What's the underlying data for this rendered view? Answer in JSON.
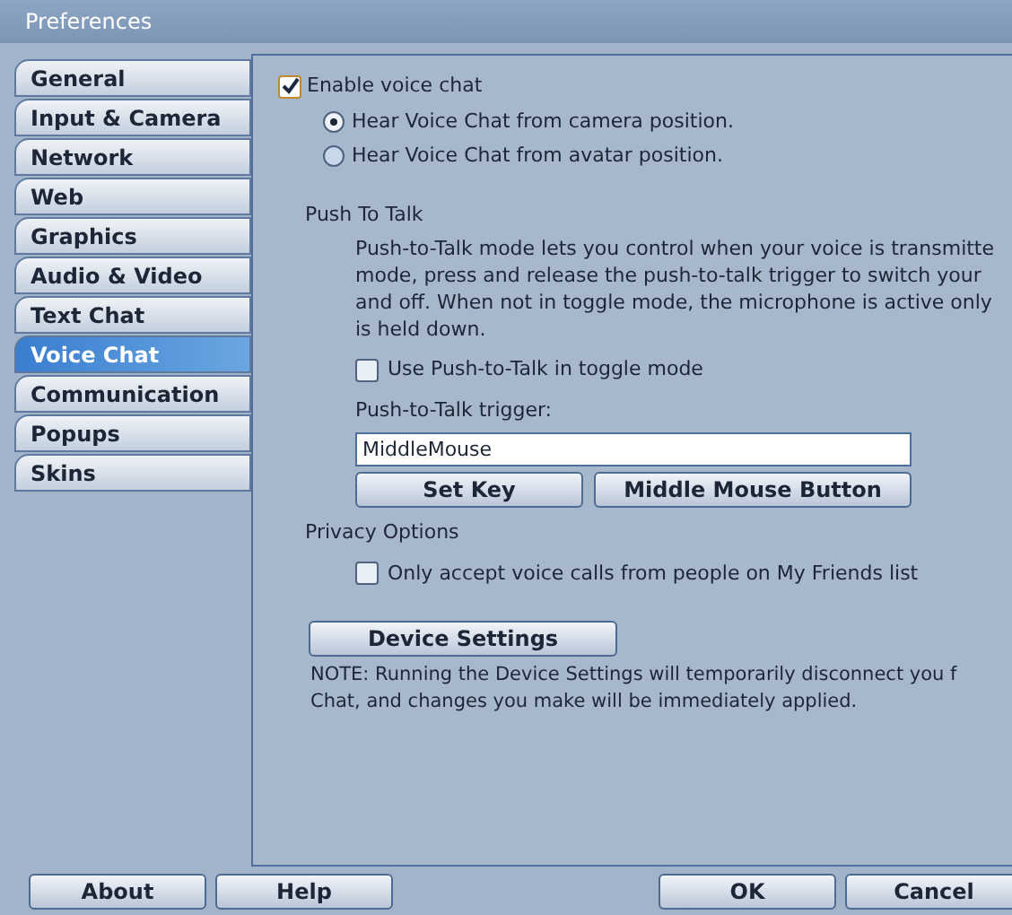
{
  "window": {
    "title": "Preferences"
  },
  "tabs": [
    {
      "label": "General",
      "selected": false
    },
    {
      "label": "Input & Camera",
      "selected": false
    },
    {
      "label": "Network",
      "selected": false
    },
    {
      "label": "Web",
      "selected": false
    },
    {
      "label": "Graphics",
      "selected": false
    },
    {
      "label": "Audio & Video",
      "selected": false
    },
    {
      "label": "Text Chat",
      "selected": false
    },
    {
      "label": "Voice Chat",
      "selected": true
    },
    {
      "label": "Communication",
      "selected": false
    },
    {
      "label": "Popups",
      "selected": false
    },
    {
      "label": "Skins",
      "selected": false
    }
  ],
  "enable_voice": {
    "label": "Enable voice chat",
    "checked": true
  },
  "hear_from": [
    {
      "label": "Hear Voice Chat from camera position.",
      "selected": true
    },
    {
      "label": "Hear Voice Chat from avatar position.",
      "selected": false
    }
  ],
  "push_to_talk": {
    "heading": "Push To Talk",
    "description_lines": [
      "Push-to-Talk mode lets you control when your voice is transmitte",
      "mode, press and release the push-to-talk trigger to switch your",
      "and off. When not in toggle mode, the microphone is active only",
      "is held down."
    ],
    "toggle": {
      "label": "Use Push-to-Talk in toggle mode",
      "checked": false
    },
    "trigger_label": "Push-to-Talk trigger:",
    "trigger_value": "MiddleMouse",
    "buttons": [
      "Set Key",
      "Middle Mouse Button"
    ]
  },
  "privacy": {
    "heading": "Privacy Options",
    "friends_only": {
      "label": "Only accept voice calls from people on My Friends list",
      "checked": false
    }
  },
  "device_settings": {
    "button": "Device Settings",
    "note_lines": [
      "NOTE: Running the Device Settings will temporarily disconnect you f",
      "Chat, and changes you make will be immediately applied."
    ]
  },
  "footer_left": [
    "About",
    "Help"
  ],
  "footer_right": [
    "OK",
    "Cancel"
  ]
}
